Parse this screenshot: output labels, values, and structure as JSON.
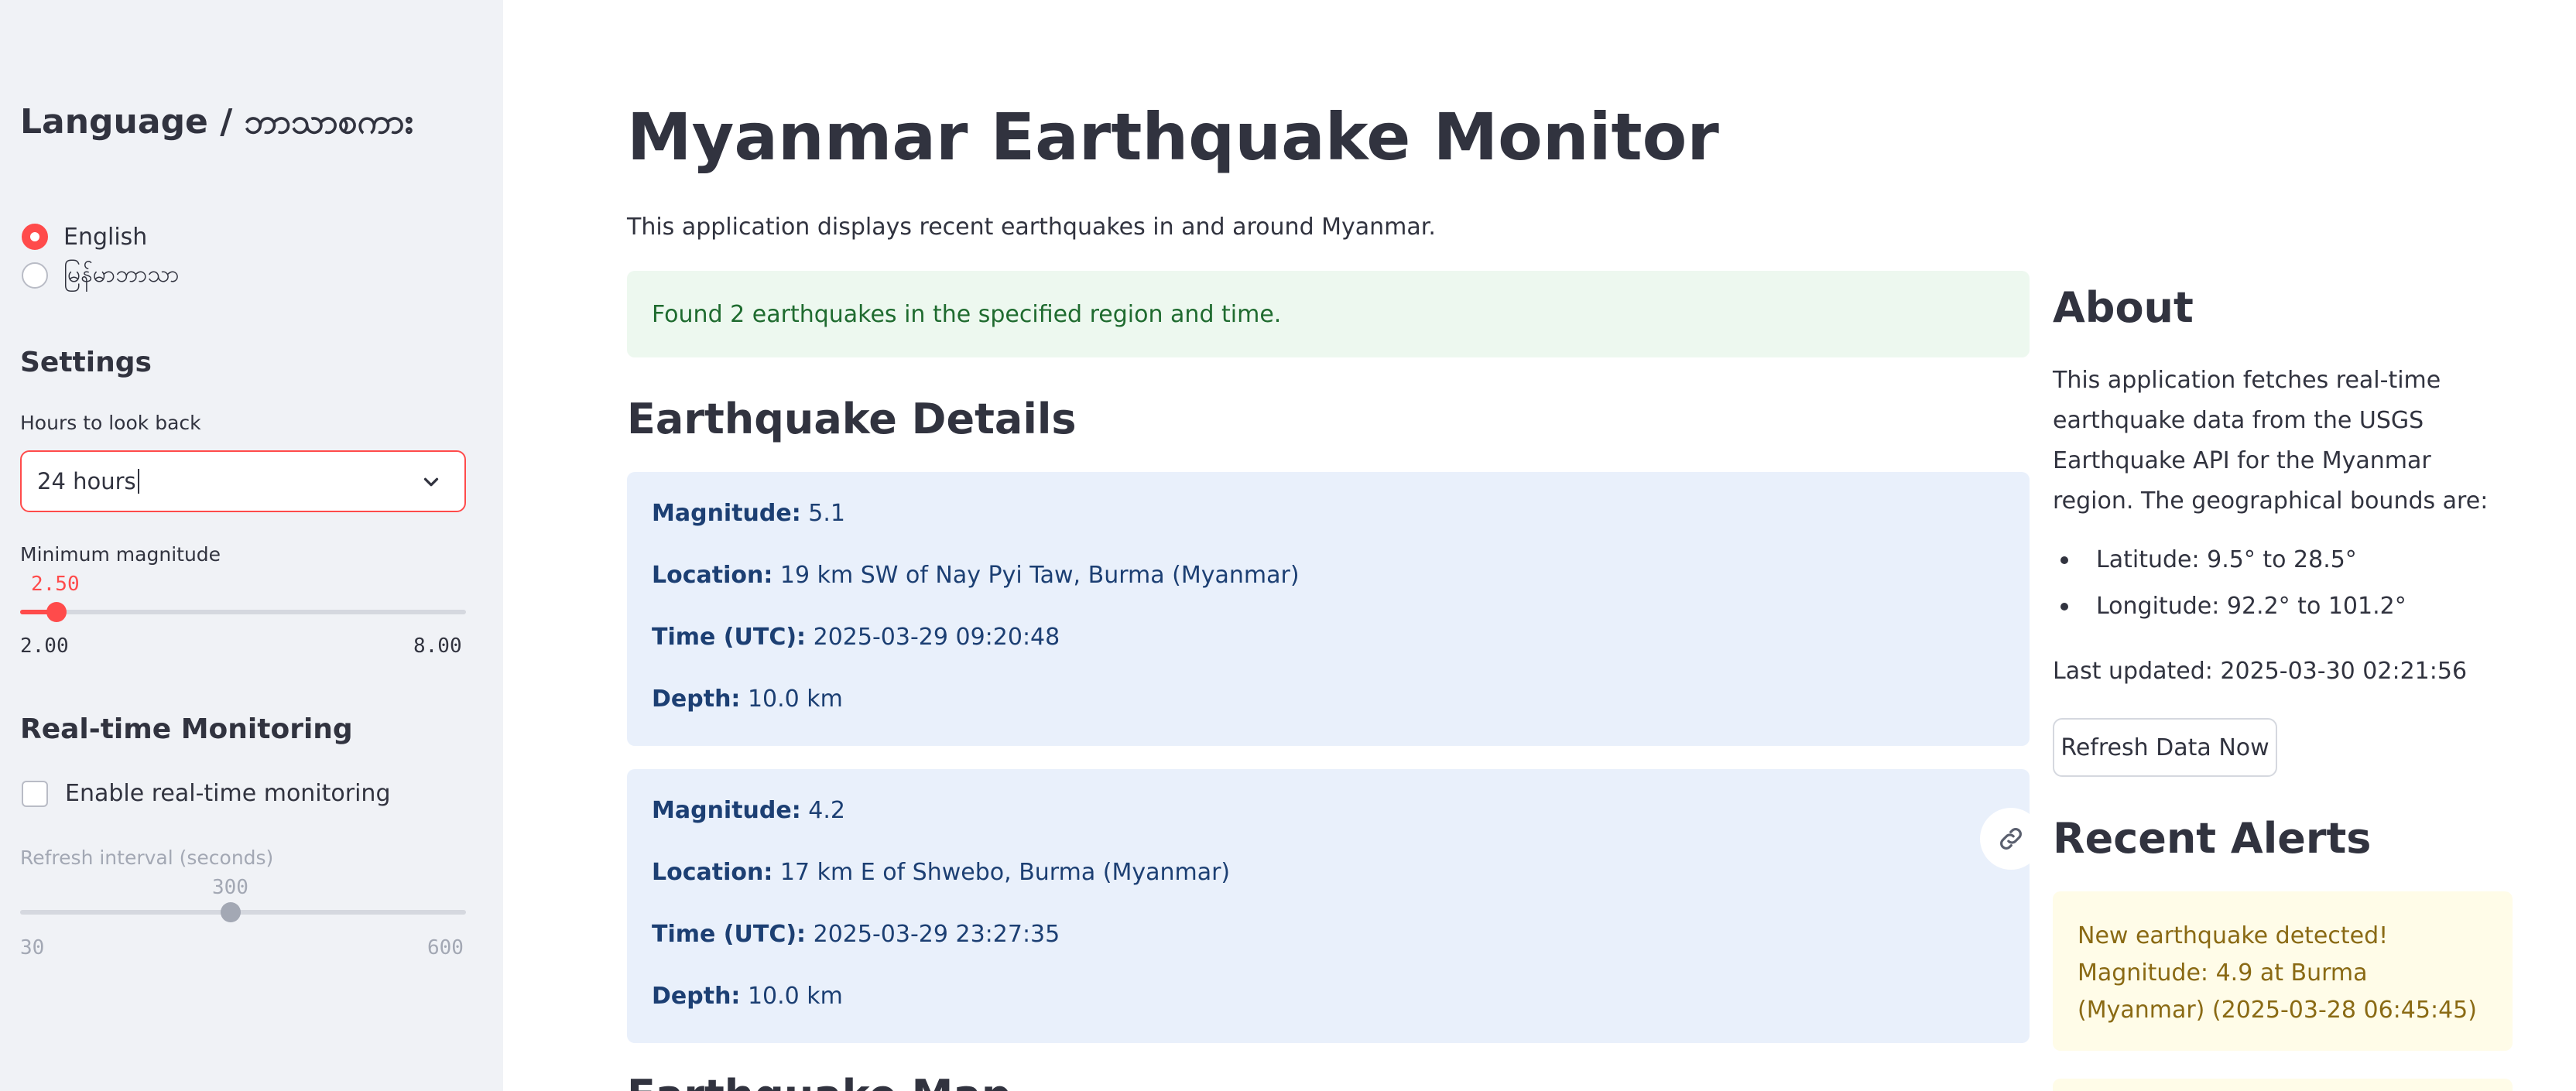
{
  "sidebar": {
    "language_heading": "Language / ဘာသာစကား",
    "language_options": [
      {
        "label": "English",
        "checked": true
      },
      {
        "label": "မြန်မာဘာသာ",
        "checked": false
      }
    ],
    "settings_heading": "Settings",
    "hours_label": "Hours to look back",
    "hours_value": "24 hours",
    "min_mag_label": "Minimum magnitude",
    "min_mag_value": "2.50",
    "min_mag_min": "2.00",
    "min_mag_max": "8.00",
    "realtime_heading": "Real-time Monitoring",
    "realtime_checkbox_label": "Enable real-time monitoring",
    "refresh_label": "Refresh interval (seconds)",
    "refresh_value": "300",
    "refresh_min": "30",
    "refresh_max": "600"
  },
  "main": {
    "title": "Myanmar Earthquake Monitor",
    "subtitle": "This application displays recent earthquakes in and around Myanmar.",
    "success_message": "Found 2 earthquakes in the specified region and time.",
    "details_heading": "Earthquake Details",
    "labels": {
      "magnitude": "Magnitude:",
      "location": "Location:",
      "time": "Time (UTC):",
      "depth": "Depth:"
    },
    "quakes": [
      {
        "magnitude": "5.1",
        "location": "19 km SW of Nay Pyi Taw, Burma (Myanmar)",
        "time": "2025-03-29 09:20:48",
        "depth": "10.0 km"
      },
      {
        "magnitude": "4.2",
        "location": "17 km E of Shwebo, Burma (Myanmar)",
        "time": "2025-03-29 23:27:35",
        "depth": "10.0 km"
      }
    ],
    "next_heading": "Earthquake Map"
  },
  "about": {
    "title": "About",
    "text": "This application fetches real-time earthquake data from the USGS Earthquake API for the Myanmar region. The geographical bounds are:",
    "bullets": [
      "Latitude: 9.5° to 28.5°",
      "Longitude: 92.2° to 101.2°"
    ],
    "last_updated": "Last updated: 2025-03-30 02:21:56",
    "refresh_button": "Refresh Data Now"
  },
  "alerts": {
    "title": "Recent Alerts",
    "items": [
      "New earthquake detected! Magnitude: 4.9 at Burma (Myanmar) (2025-03-28 06:45:45)"
    ]
  },
  "colors": {
    "accent": "#ff4b4b",
    "sidebar_bg": "#f0f2f6",
    "success_bg": "#edf8ef",
    "info_bg": "#e9f0fb",
    "warning_bg": "#fffce8"
  }
}
